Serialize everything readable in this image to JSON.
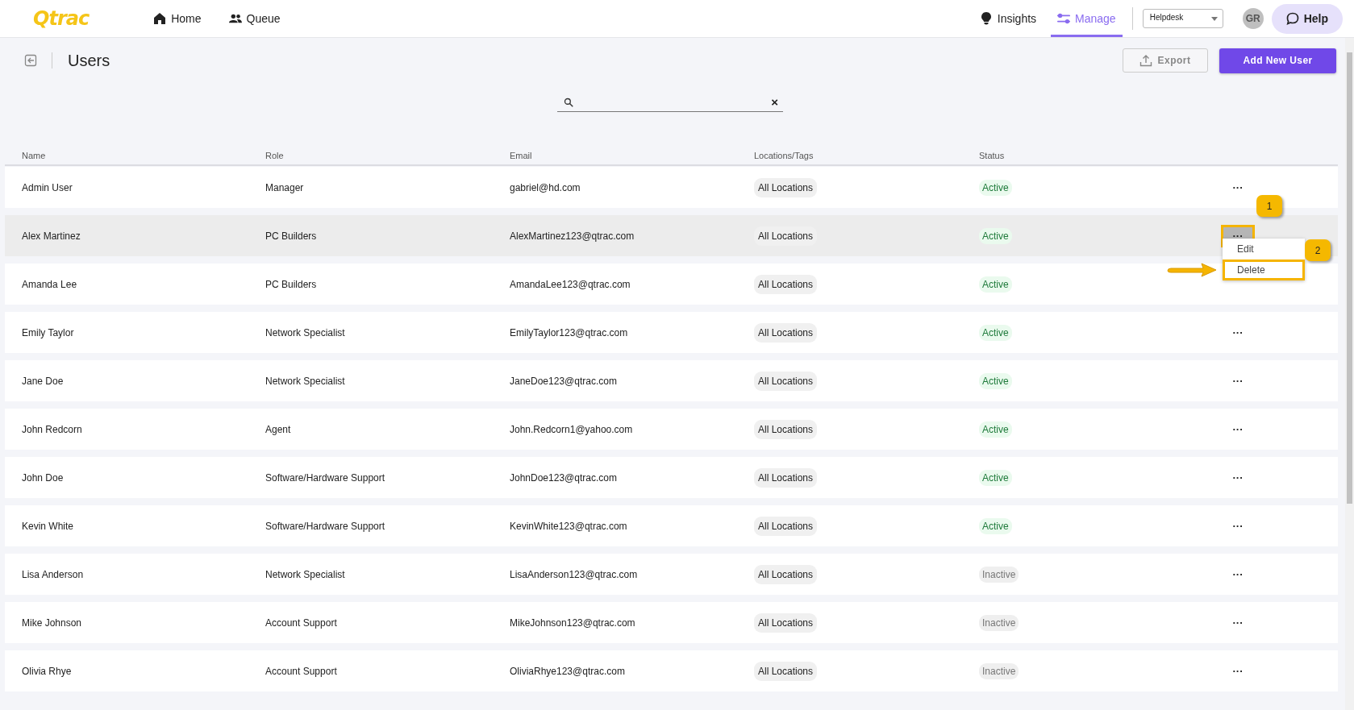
{
  "top_nav": {
    "logo": "Qtrac",
    "items": [
      {
        "label": "Home",
        "selected": false
      },
      {
        "label": "Queue",
        "selected": false
      }
    ],
    "right_items": [
      {
        "label": "Insights",
        "selected": false
      },
      {
        "label": "Manage",
        "selected": true
      }
    ],
    "workspace_select": {
      "value": "Helpdesk"
    },
    "avatar": "GR",
    "help_button": "Help"
  },
  "page": {
    "title": "Users",
    "export_button": "Export",
    "add_button": "Add New User"
  },
  "search": {
    "clear": "×"
  },
  "table": {
    "columns": [
      "Name",
      "Role",
      "Email",
      "Locations/Tags",
      "Status"
    ],
    "rows": [
      {
        "name": "Admin User",
        "role": "Manager",
        "email": "gabriel@hd.com",
        "location": "All Locations",
        "status": "Active",
        "active": true,
        "more": "···",
        "selected": false
      },
      {
        "name": "Alex Martinez",
        "role": "PC Builders",
        "email": "AlexMartinez123@qtrac.com",
        "location": "All Locations",
        "status": "Active",
        "active": true,
        "more": "···",
        "selected": true,
        "menu": {
          "items": [
            {
              "label": "Edit",
              "highlighted": false
            },
            {
              "label": "Delete",
              "highlighted": true,
              "callout": "2"
            }
          ]
        },
        "more_highlighted": true,
        "callout": "1"
      },
      {
        "name": "Amanda Lee",
        "role": "PC Builders",
        "email": "AmandaLee123@qtrac.com",
        "location": "All Locations",
        "status": "Active",
        "active": true,
        "selected": false
      },
      {
        "name": "Emily Taylor",
        "role": "Network Specialist",
        "email": "EmilyTaylor123@qtrac.com",
        "location": "All Locations",
        "status": "Active",
        "active": true,
        "more": "···",
        "selected": false
      },
      {
        "name": "Jane Doe",
        "role": "Network Specialist",
        "email": "JaneDoe123@qtrac.com",
        "location": "All Locations",
        "status": "Active",
        "active": true,
        "more": "···",
        "selected": false
      },
      {
        "name": "John Redcorn",
        "role": "Agent",
        "email": "John.Redcorn1@yahoo.com",
        "location": "All Locations",
        "status": "Active",
        "active": true,
        "more": "···",
        "selected": false
      },
      {
        "name": "John Doe",
        "role": "Software/Hardware Support",
        "email": "JohnDoe123@qtrac.com",
        "location": "All Locations",
        "status": "Active",
        "active": true,
        "more": "···",
        "selected": false
      },
      {
        "name": "Kevin White",
        "role": "Software/Hardware Support",
        "email": "KevinWhite123@qtrac.com",
        "location": "All Locations",
        "status": "Active",
        "active": true,
        "more": "···",
        "selected": false
      },
      {
        "name": "Lisa Anderson",
        "role": "Network Specialist",
        "email": "LisaAnderson123@qtrac.com",
        "location": "All Locations",
        "status": "Inactive",
        "active": false,
        "more": "···",
        "selected": false
      },
      {
        "name": "Mike Johnson",
        "role": "Account Support",
        "email": "MikeJohnson123@qtrac.com",
        "location": "All Locations",
        "status": "Inactive",
        "active": false,
        "more": "···",
        "selected": false
      },
      {
        "name": "Olivia Rhye",
        "role": "Account Support",
        "email": "OliviaRhye123@qtrac.com",
        "location": "All Locations",
        "status": "Inactive",
        "active": false,
        "more": "···",
        "selected": false
      }
    ]
  }
}
